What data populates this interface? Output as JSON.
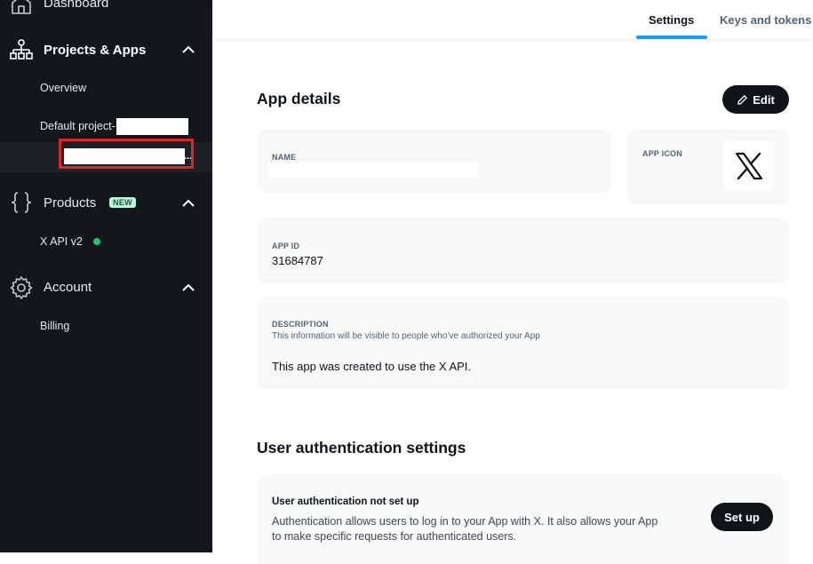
{
  "sidebar": {
    "dashboard_label": "Dashboard",
    "projects_label": "Projects & Apps",
    "overview_label": "Overview",
    "default_project_label": "Default project-",
    "products_label": "Products",
    "new_badge": "NEW",
    "x_api_label": "X API v2",
    "account_label": "Account",
    "billing_label": "Billing",
    "ellipsis": "..."
  },
  "tabs": [
    {
      "label": "Settings",
      "active": true
    },
    {
      "label": "Keys and tokens",
      "active": false
    }
  ],
  "app_details": {
    "heading": "App details",
    "edit_label": "Edit",
    "name_label": "NAME",
    "app_icon_label": "APP ICON",
    "app_id_label": "APP ID",
    "app_id_value": "31684787",
    "description_label": "DESCRIPTION",
    "description_hint": "This information will be visible to people who’ve authorized your App",
    "description_value": "This app was created to use the X API."
  },
  "user_auth": {
    "heading": "User authentication settings",
    "status_title": "User authentication not set up",
    "status_line1": "Authentication allows users to log in to your App with X. It also allows your App",
    "status_line2": "to make specific requests for authenticated users.",
    "setup_label": "Set up"
  },
  "colors": {
    "sidebar_bg": "#14171a",
    "accent": "#1d9bf0",
    "highlight": "#e0242a",
    "status_green": "#1bc47d"
  },
  "icons": [
    "home-icon",
    "sitemap-icon",
    "chevron-up-icon",
    "braces-icon",
    "gear-icon",
    "pencil-icon",
    "x-logo-icon"
  ]
}
